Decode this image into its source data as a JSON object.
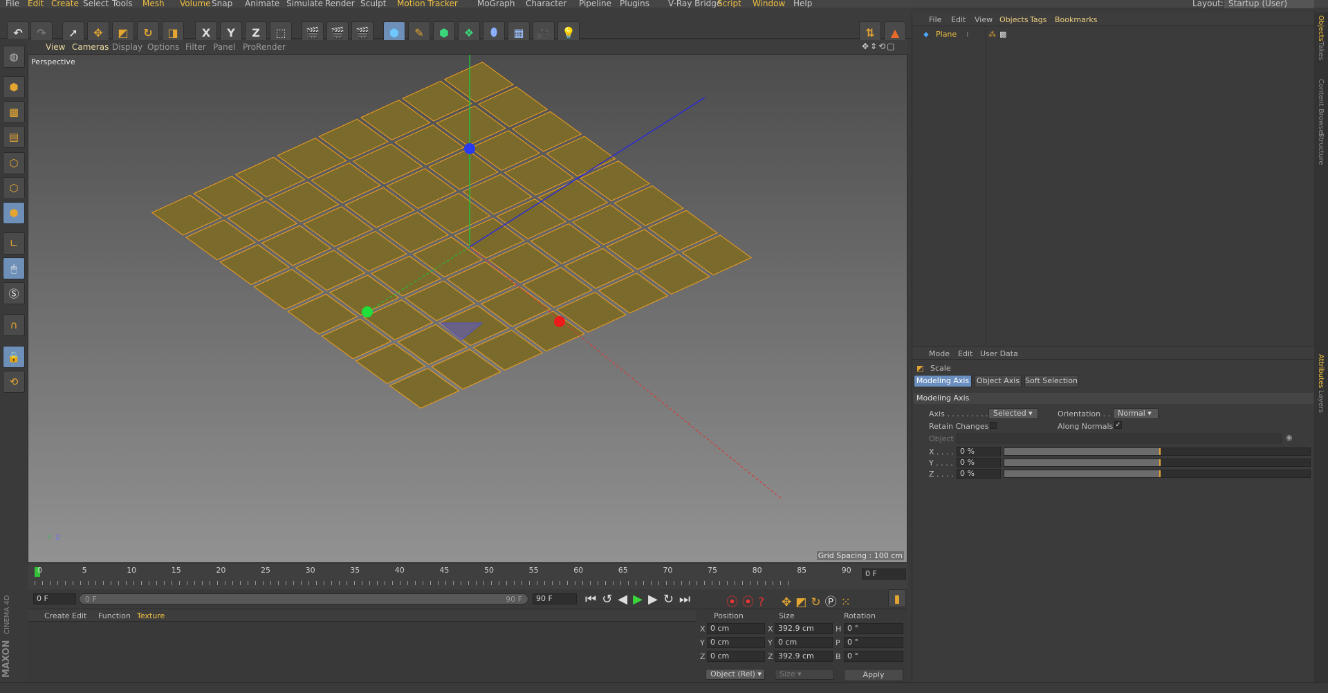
{
  "menu": {
    "items": [
      "File",
      "Edit",
      "Create",
      "Select",
      "Tools",
      "Mesh",
      "Volume",
      "Snap",
      "Animate",
      "Simulate",
      "Render",
      "Sculpt",
      "Motion Tracker",
      "MoGraph",
      "Character",
      "Pipeline",
      "Plugins",
      "V-Ray Bridge",
      "Script",
      "Window",
      "Help"
    ],
    "layout_label": "Layout:",
    "layout_value": "Startup (User)"
  },
  "toolbar": {
    "axis_x": "X",
    "axis_y": "Y",
    "axis_z": "Z"
  },
  "viewport": {
    "menu": [
      "View",
      "Cameras",
      "Display",
      "Options",
      "Filter",
      "Panel",
      "ProRender"
    ],
    "label": "Perspective",
    "grid_spacing": "Grid Spacing : 100 cm"
  },
  "timeline": {
    "ticks": [
      "0",
      "5",
      "10",
      "15",
      "20",
      "25",
      "30",
      "35",
      "40",
      "45",
      "50",
      "55",
      "60",
      "65",
      "70",
      "75",
      "80",
      "85",
      "90"
    ],
    "frame_field": "0 F",
    "start_field": "0 F",
    "range_start": "0 F",
    "range_end": "90 F",
    "end_field": "90 F"
  },
  "material_panel": {
    "menu": [
      "Create",
      "Edit",
      "Function",
      "Texture"
    ]
  },
  "coords": {
    "headers": [
      "Position",
      "Size",
      "Rotation"
    ],
    "rows": [
      {
        "axis": "X",
        "pos": "0 cm",
        "size_axis": "X",
        "size": "392.9 cm",
        "rot_axis": "H",
        "rot": "0 °"
      },
      {
        "axis": "Y",
        "pos": "0 cm",
        "size_axis": "Y",
        "size": "0 cm",
        "rot_axis": "P",
        "rot": "0 °"
      },
      {
        "axis": "Z",
        "pos": "0 cm",
        "size_axis": "Z",
        "size": "392.9 cm",
        "rot_axis": "B",
        "rot": "0 °"
      }
    ],
    "mode_dropdown": "Object (Rel)",
    "size_dropdown": "Size",
    "apply": "Apply"
  },
  "objects_panel": {
    "menu": [
      "File",
      "Edit",
      "View",
      "Objects",
      "Tags",
      "Bookmarks"
    ],
    "object_name": "Plane"
  },
  "attributes_panel": {
    "menu": [
      "Mode",
      "Edit",
      "User Data"
    ],
    "tool_name": "Scale",
    "tabs": [
      "Modeling Axis",
      "Object Axis",
      "Soft Selection"
    ],
    "section": "Modeling Axis",
    "axis_label": "Axis . . . . . . . . . .",
    "axis_value": "Selected",
    "orientation_label": "Orientation . .",
    "orientation_value": "Normal",
    "retain_label": "Retain Changes",
    "along_normals_label": "Along Normals",
    "object_label": "Object",
    "sliders": [
      {
        "label": "X . . . .",
        "value": "0 %"
      },
      {
        "label": "Y . . . .",
        "value": "0 %"
      },
      {
        "label": "Z . . . .",
        "value": "0 %"
      }
    ]
  },
  "side_tabs": [
    "Objects",
    "Takes",
    "Content Browser",
    "Structure"
  ],
  "side_tabs_lower": [
    "Attributes",
    "Layers"
  ],
  "brand": {
    "line1": "MAXON",
    "line2": "CINEMA 4D"
  },
  "colors": {
    "accent": "#e4a631",
    "active_blue": "#6d8fb8",
    "poly": "#7a6a2c",
    "poly_edge": "#f0a020"
  }
}
